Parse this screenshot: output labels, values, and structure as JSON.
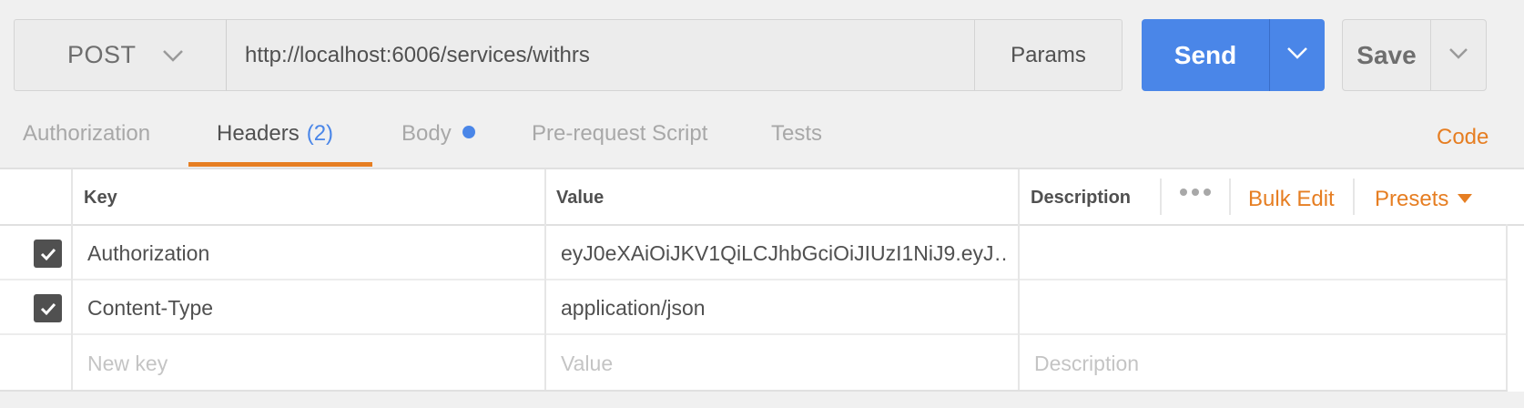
{
  "request": {
    "method": "POST",
    "url": "http://localhost:6006/services/withrs",
    "params_label": "Params",
    "send_label": "Send",
    "save_label": "Save"
  },
  "tabs": [
    {
      "label": "Authorization",
      "active": false
    },
    {
      "label": "Headers",
      "count": "(2)",
      "active": true
    },
    {
      "label": "Body",
      "indicator": "dot",
      "active": false
    },
    {
      "label": "Pre-request Script",
      "active": false
    },
    {
      "label": "Tests",
      "active": false
    }
  ],
  "code_link": "Code",
  "headers_table": {
    "columns": {
      "key": "Key",
      "value": "Value",
      "description": "Description"
    },
    "bulk_edit": "Bulk Edit",
    "presets": "Presets",
    "rows": [
      {
        "checked": true,
        "key": "Authorization",
        "value": "eyJ0eXAiOiJKV1QiLCJhbGciOiJIUzI1NiJ9.eyJ…",
        "description": ""
      },
      {
        "checked": true,
        "key": "Content-Type",
        "value": "application/json",
        "description": ""
      }
    ],
    "new_row": {
      "key_placeholder": "New key",
      "value_placeholder": "Value",
      "description_placeholder": "Description"
    }
  },
  "colors": {
    "accent": "#e67e22",
    "primary": "#4a86e8",
    "checkbox": "#505050"
  }
}
